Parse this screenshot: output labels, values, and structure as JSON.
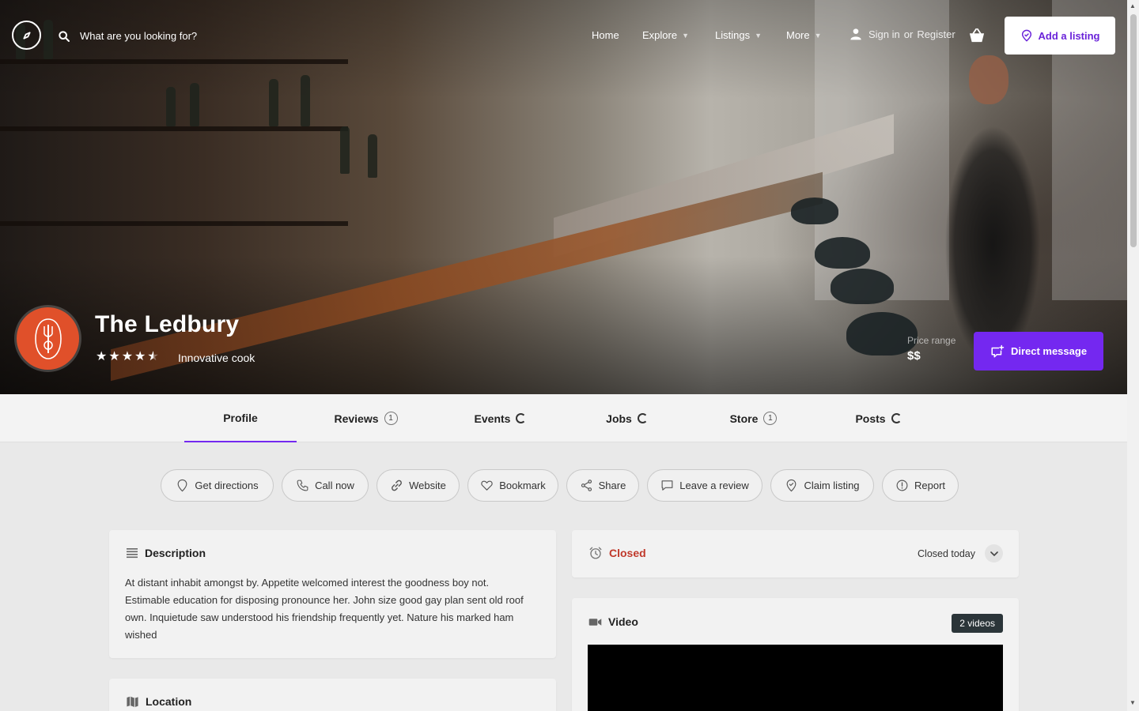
{
  "nav": {
    "search_placeholder": "What are you looking for?",
    "items": [
      {
        "label": "Home",
        "has_dropdown": false
      },
      {
        "label": "Explore",
        "has_dropdown": true
      },
      {
        "label": "Listings",
        "has_dropdown": true
      },
      {
        "label": "More",
        "has_dropdown": true
      }
    ],
    "sign_in": "Sign in",
    "or": "or",
    "register": "Register",
    "add_listing": "Add a listing"
  },
  "listing": {
    "title": "The Ledbury",
    "rating": 4.5,
    "tagline": "Innovative cook",
    "price_label": "Price range",
    "price_value": "$$",
    "direct_message": "Direct message"
  },
  "tabs": [
    {
      "label": "Profile",
      "badge": "",
      "active": true
    },
    {
      "label": "Reviews",
      "badge": "1"
    },
    {
      "label": "Events",
      "badge": "loading"
    },
    {
      "label": "Jobs",
      "badge": "loading"
    },
    {
      "label": "Store",
      "badge": "1"
    },
    {
      "label": "Posts",
      "badge": "loading"
    }
  ],
  "actions": [
    {
      "label": "Get directions",
      "icon": "map-pin-icon"
    },
    {
      "label": "Call now",
      "icon": "phone-icon"
    },
    {
      "label": "Website",
      "icon": "link-icon"
    },
    {
      "label": "Bookmark",
      "icon": "heart-icon"
    },
    {
      "label": "Share",
      "icon": "share-icon"
    },
    {
      "label": "Leave a review",
      "icon": "comment-icon"
    },
    {
      "label": "Claim listing",
      "icon": "badge-icon"
    },
    {
      "label": "Report",
      "icon": "alert-icon"
    }
  ],
  "description": {
    "title": "Description",
    "text": "At distant inhabit amongst by. Appetite welcomed interest the goodness boy not. Estimable education for disposing pronounce her. John size good gay plan sent old roof own. Inquietude saw understood his friendship frequently yet. Nature his marked ham wished"
  },
  "hours": {
    "status": "Closed",
    "detail": "Closed today"
  },
  "video": {
    "title": "Video",
    "count": "2 videos"
  },
  "location": {
    "title": "Location"
  },
  "colors": {
    "accent": "#7428f0",
    "closed": "#c0392b",
    "logo_bg": "#e0502a"
  }
}
